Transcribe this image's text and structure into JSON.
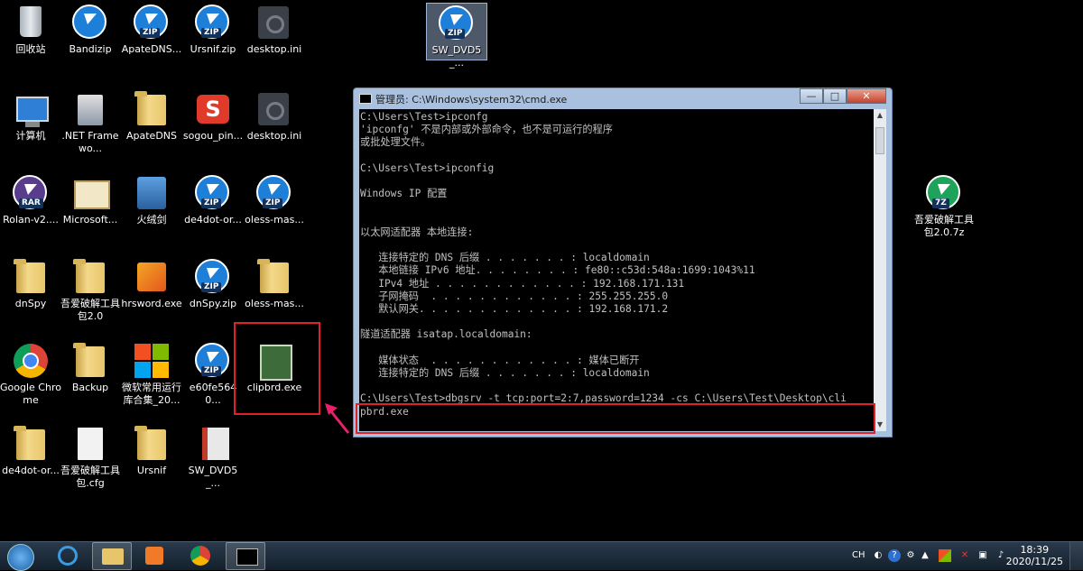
{
  "desktop": {
    "icons": [
      {
        "label": "回收站"
      },
      {
        "label": "Bandizip"
      },
      {
        "label": "ApateDNS..."
      },
      {
        "label": "Ursnif.zip"
      },
      {
        "label": "desktop.ini"
      },
      {
        "label": "SW_DVD5_..."
      },
      {
        "label": "计算机"
      },
      {
        "label": ".NET Framewo..."
      },
      {
        "label": "ApateDNS"
      },
      {
        "label": "sogou_pin..."
      },
      {
        "label": "desktop.ini"
      },
      {
        "label": "Rolan-v2...."
      },
      {
        "label": "Microsoft..."
      },
      {
        "label": "火绒剑"
      },
      {
        "label": "de4dot-or..."
      },
      {
        "label": "oless-mas..."
      },
      {
        "label": "吾爱破解工具包2.0.7z"
      },
      {
        "label": "dnSpy"
      },
      {
        "label": "吾爱破解工具包2.0"
      },
      {
        "label": "hrsword.exe"
      },
      {
        "label": "dnSpy.zip"
      },
      {
        "label": "oless-mas..."
      },
      {
        "label": "Google Chrome"
      },
      {
        "label": "Backup"
      },
      {
        "label": "微软常用运行库合集_20..."
      },
      {
        "label": "e60fe5640..."
      },
      {
        "label": "clipbrd.exe"
      },
      {
        "label": "de4dot-or..."
      },
      {
        "label": "吾爱破解工具包.cfg"
      },
      {
        "label": "Ursnif"
      },
      {
        "label": "SW_DVD5_..."
      }
    ],
    "tags": {
      "zip": "ZIP",
      "rar": "RAR",
      "z7": "7Z"
    }
  },
  "cmd": {
    "title": "管理员: C:\\Windows\\system32\\cmd.exe",
    "btn_min": "—",
    "btn_max": "□",
    "btn_close": "✕",
    "output": "C:\\Users\\Test>ipconfg\n'ipconfg' 不是内部或外部命令，也不是可运行的程序\n或批处理文件。\n\nC:\\Users\\Test>ipconfig\n\nWindows IP 配置\n\n\n以太网适配器 本地连接:\n\n   连接特定的 DNS 后缀 . . . . . . . : localdomain\n   本地链接 IPv6 地址. . . . . . . . : fe80::c53d:548a:1699:1043%11\n   IPv4 地址 . . . . . . . . . . . . : 192.168.171.131\n   子网掩码  . . . . . . . . . . . . : 255.255.255.0\n   默认网关. . . . . . . . . . . . . : 192.168.171.2\n\n隧道适配器 isatap.localdomain:\n\n   媒体状态  . . . . . . . . . . . . : 媒体已断开\n   连接特定的 DNS 后缀 . . . . . . . : localdomain\n\nC:\\Users\\Test>dbgsrv -t tcp:port=2:7,password=1234 -cs C:\\Users\\Test\\Desktop\\cli\npbrd.exe"
  },
  "taskbar": {
    "lang": "CH",
    "time": "18:39",
    "date": "2020/11/25"
  },
  "colors": {
    "highlight": "#e0202a",
    "arrow": "#e8206a",
    "console_text": "#c0c0c0"
  }
}
